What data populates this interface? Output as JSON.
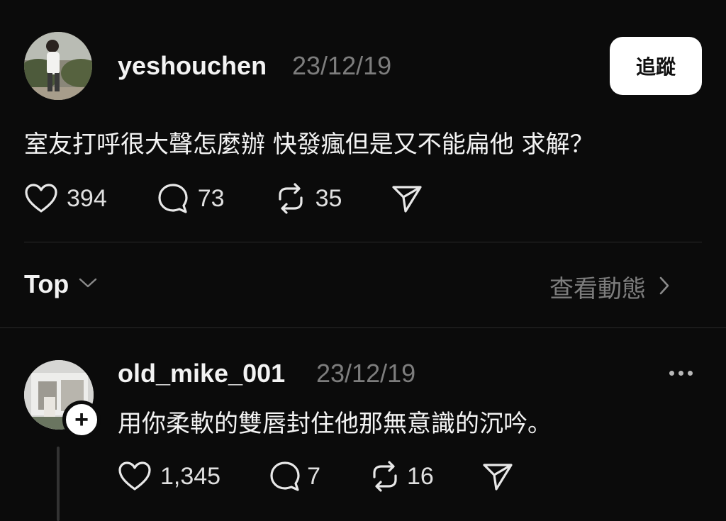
{
  "post": {
    "username": "yeshouchen",
    "timestamp": "23/12/19",
    "follow_label": "追蹤",
    "text": "室友打呼很大聲怎麼辦 快發瘋但是又不能扁他 求解？",
    "likes": "394",
    "comments": "73",
    "reposts": "35"
  },
  "filter": {
    "sort_label": "Top",
    "view_activity_label": "查看動態"
  },
  "reply": {
    "username": "old_mike_001",
    "timestamp": "23/12/19",
    "text": "用你柔軟的雙唇封住他那無意識的沉吟。",
    "likes": "1,345",
    "comments": "7",
    "reposts": "16"
  },
  "icons": {
    "like": "heart-icon",
    "comment": "speech-bubble-icon",
    "repost": "repost-icon",
    "share": "send-icon",
    "sort_chevron": "chevron-down-icon",
    "activity_chevron": "chevron-right-icon",
    "more": "more-horizontal-icon",
    "follow_badge": "plus-icon"
  },
  "colors": {
    "background": "#0b0b0b",
    "primary_text": "#f3f3f3",
    "secondary_text": "#7d7d7d",
    "follow_button": "#ffffff"
  }
}
